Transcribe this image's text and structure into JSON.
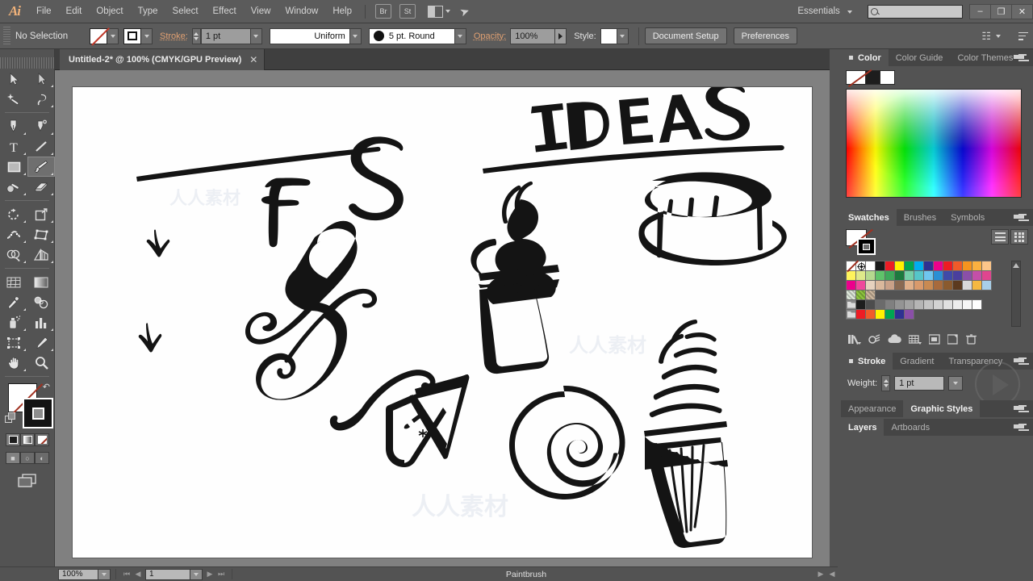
{
  "app": {
    "name": "Adobe Illustrator",
    "logo": "Ai"
  },
  "menubar": {
    "items": [
      "File",
      "Edit",
      "Object",
      "Type",
      "Select",
      "Effect",
      "View",
      "Window",
      "Help"
    ],
    "bridge_label": "Br",
    "stock_label": "St",
    "workspace": "Essentials",
    "search_placeholder": "",
    "window_buttons": {
      "minimize": "–",
      "restore": "❐",
      "close": "✕"
    }
  },
  "control_bar": {
    "selection_status": "No Selection",
    "stroke_label": "Stroke:",
    "stroke_weight": "1 pt",
    "profile": "Uniform",
    "brush": "5 pt. Round",
    "opacity_label": "Opacity:",
    "opacity_value": "100%",
    "style_label": "Style:",
    "document_setup": "Document Setup",
    "preferences": "Preferences"
  },
  "tabs": {
    "document": "Untitled-2* @ 100% (CMYK/GPU Preview)",
    "close_glyph": "✕"
  },
  "toolbar": {
    "tools": [
      "selection-tool",
      "direct-selection-tool",
      "magic-wand-tool",
      "lasso-tool",
      "pen-tool",
      "curvature-tool",
      "type-tool",
      "line-segment-tool",
      "rectangle-tool",
      "paintbrush-tool",
      "shaper-tool",
      "eraser-tool",
      "rotate-tool",
      "scale-tool",
      "width-tool",
      "free-transform-tool",
      "shape-builder-tool",
      "perspective-grid-tool",
      "mesh-tool",
      "gradient-tool",
      "eyedropper-tool",
      "blend-tool",
      "symbol-sprayer-tool",
      "column-graph-tool",
      "artboard-tool",
      "slice-tool",
      "hand-tool",
      "zoom-tool"
    ],
    "active_tool": "paintbrush-tool",
    "fill_state": "none",
    "stroke_state": "black",
    "color_modes": [
      "color-mode",
      "gradient-mode",
      "none-mode"
    ],
    "draw_modes": [
      "draw-normal",
      "draw-behind",
      "draw-inside"
    ],
    "screen_mode": "change-screen-mode"
  },
  "color_panel": {
    "tabs": [
      {
        "label": "Color",
        "selected": true
      },
      {
        "label": "Color Guide",
        "selected": false
      },
      {
        "label": "Color Themes",
        "selected": false
      }
    ]
  },
  "swatches_panel": {
    "tabs": [
      {
        "label": "Swatches",
        "selected": true
      },
      {
        "label": "Brushes",
        "selected": false
      },
      {
        "label": "Symbols",
        "selected": false
      }
    ],
    "rows": [
      [
        "none",
        "registration",
        "#ffffff",
        "#1a1a1a",
        "#ed1c24",
        "#fff200",
        "#00a651",
        "#00aeef",
        "#2e3192",
        "#ec008c",
        "#ed1c24",
        "#f15a29",
        "#f7941e",
        "#fbb040",
        "#fdc689"
      ],
      [
        "#fff45c",
        "#dfe98a",
        "#b5d98f",
        "#5fc36a",
        "#3ea95a",
        "#1c7a3e",
        "#74cfa8",
        "#55c6c9",
        "#6fc6ef",
        "#2b8fd4",
        "#3f4aa8",
        "#4a3f9e",
        "#8a4fa8",
        "#c44fa8",
        "#e0458f"
      ],
      [
        "#ec008c",
        "#f0479c",
        "#e6d2be",
        "#d9b89c",
        "#c9a188",
        "#8a6a52",
        "#e0b08a",
        "#d99a6c",
        "#c98a52",
        "#a86a3c",
        "#8a5a2e",
        "#5c3a1e",
        "#d8d8d8",
        "#f5b841",
        "#a8cfe8"
      ],
      [
        "pattern-circle",
        "pattern-leaf",
        "pattern-weave"
      ],
      [
        "folder",
        "#1d1d1d",
        "#4d4d4d",
        "#6b6b6b",
        "#808080",
        "#949494",
        "#a3a3a3",
        "#b5b5b5",
        "#c4c4c4",
        "#d2d2d2",
        "#e0e0e0",
        "#ededed",
        "#f7f7f7",
        "#ffffff"
      ],
      [
        "folder",
        "#ed1c24",
        "#f15a29",
        "#fff200",
        "#00a651",
        "#2e3192",
        "#8a4fa8"
      ]
    ],
    "footer_icons": [
      "swatch-libraries-icon",
      "show-swatch-kinds-icon",
      "cc-libraries-icon",
      "swatch-options-icon",
      "color-group-icon",
      "new-swatch-icon",
      "delete-swatch-icon"
    ]
  },
  "stroke_panel": {
    "tabs": [
      {
        "label": "Stroke",
        "selected": true
      },
      {
        "label": "Gradient",
        "selected": false
      },
      {
        "label": "Transparency",
        "selected": false
      }
    ],
    "weight_label": "Weight:",
    "weight_value": "1 pt"
  },
  "appearance_panel": {
    "tabs": [
      {
        "label": "Appearance",
        "selected": false
      },
      {
        "label": "Graphic Styles",
        "selected": true
      }
    ]
  },
  "layers_panel": {
    "tabs": [
      {
        "label": "Layers",
        "selected": true
      },
      {
        "label": "Artboards",
        "selected": false
      }
    ]
  },
  "status_bar": {
    "zoom": "100%",
    "page": "1",
    "tool_name": "Paintbrush"
  },
  "artwork": {
    "title_left": "F S",
    "title_right": "IDEAS",
    "elements": [
      "heading-fs",
      "underline-left",
      "heading-ideas",
      "underline-right",
      "calligraphic-f-flourish",
      "arrow-mark-upper",
      "arrow-mark-lower",
      "swoosh-flourish",
      "small-brush-sparkle",
      "cupcake-swirl-outline",
      "layer-cake-with-candles",
      "cake-slice-wedge",
      "spiral-swirl",
      "cupcake-detailed"
    ],
    "watermarks": [
      "人人素材",
      "人人素材",
      "人人素材"
    ]
  },
  "colors": {
    "chrome": "#535353",
    "chrome_light": "#5b5b5b",
    "panel_tab": "#454545",
    "canvas": "#808080",
    "artboard": "#fefefe",
    "accent_label": "#e0a072",
    "ink": "#111111"
  }
}
